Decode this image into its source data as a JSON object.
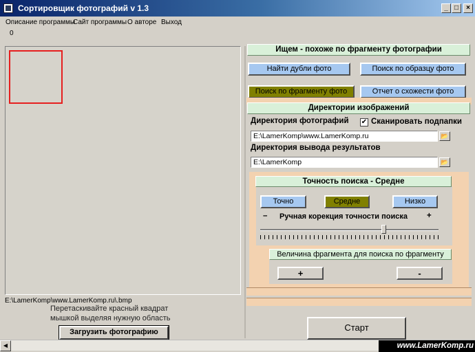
{
  "window": {
    "title": "Сортировщик фотографий v 1.3",
    "controls": {
      "minimize": "_",
      "maximize": "□",
      "close": "×"
    }
  },
  "menu": [
    "Описание программы",
    "Сайт программы",
    "О авторе",
    "Выход"
  ],
  "counter": "0",
  "left": {
    "path": "E:\\LamerKomp\\www.LamerKomp.ru\\.bmp",
    "hint_line1": "Перетаскивайте красный квадрат",
    "hint_line2": "мышкой выделяя нужную область",
    "load_button": "Загрузить фотографию"
  },
  "search": {
    "header": "Ищем - похоже по фрагменту фотографии",
    "btn_duplicates": "Найти дубли фото",
    "btn_by_sample": "Поиск по образцу фото",
    "btn_by_fragment": "Поиск по фрагменту фото",
    "btn_report": "Отчет о схожести фото"
  },
  "dirs": {
    "header": "Директории изображений",
    "photo_dir_label": "Директория фотографий",
    "scan_subfolders_label": "Сканировать подпапки",
    "scan_subfolders_checked": "✔",
    "photo_dir_value": "E:\\LamerKomp\\www.LamerKomp.ru",
    "output_dir_label": "Директория вывода результатов",
    "output_dir_value": "E:\\LamerKomp"
  },
  "accuracy": {
    "header": "Точность поиска - Средне",
    "btn_exact": "Точно",
    "btn_medium": "Средне",
    "btn_low": "Низко",
    "manual_label": "Ручная корекция точности поиска",
    "minus": "–",
    "plus": "+",
    "slider_value": 0.7
  },
  "fragment": {
    "header": "Величина фрагмента для поиска по фрагменту",
    "btn_plus": "+",
    "btn_minus": "-"
  },
  "start_button": "Старт",
  "watermark": "www.LamerKomp.ru",
  "colors": {
    "titlebar": "#0a246a",
    "button_blue": "#a6c8f0",
    "button_olive": "#808000",
    "header_green": "#d9f0d9",
    "panel_peach": "#f3d2b0",
    "selector_red": "#e61e1e"
  }
}
